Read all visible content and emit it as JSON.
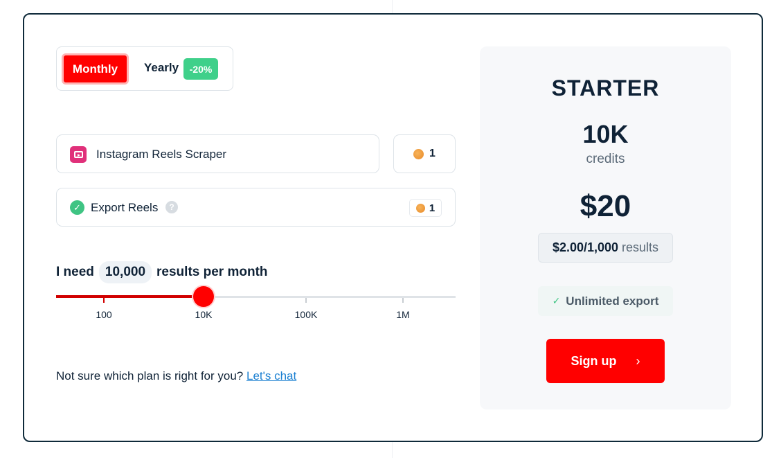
{
  "billing_toggle": {
    "monthly_label": "Monthly",
    "yearly_label": "Yearly",
    "yearly_discount": "-20%",
    "selected": "Monthly"
  },
  "actor": {
    "name": "Instagram Reels Scraper",
    "icon": "instagram-reels-icon",
    "credits": "1"
  },
  "addon": {
    "name": "Export Reels",
    "help": "?",
    "credits": "1",
    "enabled": true
  },
  "need": {
    "prefix": "I need",
    "value": "10,000",
    "suffix": "results per month"
  },
  "slider": {
    "ticks": [
      "100",
      "10K",
      "100K",
      "1M"
    ],
    "selected": "10K"
  },
  "chat": {
    "text": "Not sure which plan is right for you?",
    "link": "Let's chat"
  },
  "plan": {
    "name": "STARTER",
    "credits": "10K",
    "credits_label": "credits",
    "price": "$20",
    "rate": "$2.00/1,000",
    "rate_suffix": "results",
    "feature": "Unlimited export",
    "cta": "Sign up",
    "cta_icon": "›"
  },
  "colors": {
    "accent": "#ff0000",
    "discount": "#3fd08a",
    "dark": "#0f2236",
    "success": "#3fc483"
  }
}
